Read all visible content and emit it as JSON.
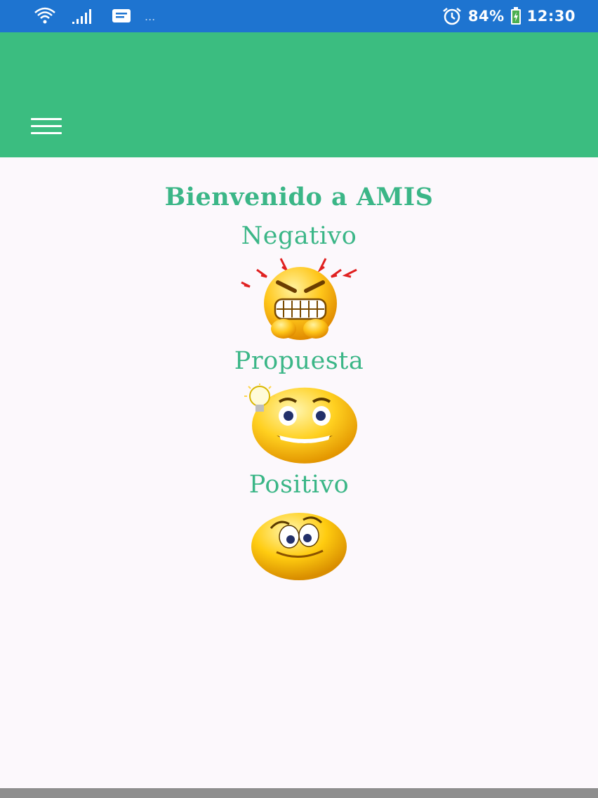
{
  "status_bar": {
    "battery": "84%",
    "time": "12:30",
    "overflow": "..."
  },
  "colors": {
    "status_bar": "#1e74d0",
    "app_bar": "#3bbd80",
    "accent_text": "#3bb687",
    "background": "#fcf8fc"
  },
  "main": {
    "title": "Bienvenido a AMIS",
    "options": [
      {
        "label": "Negativo",
        "icon": "angry-face-icon"
      },
      {
        "label": "Propuesta",
        "icon": "idea-face-icon"
      },
      {
        "label": "Positivo",
        "icon": "happy-face-icon"
      }
    ]
  }
}
